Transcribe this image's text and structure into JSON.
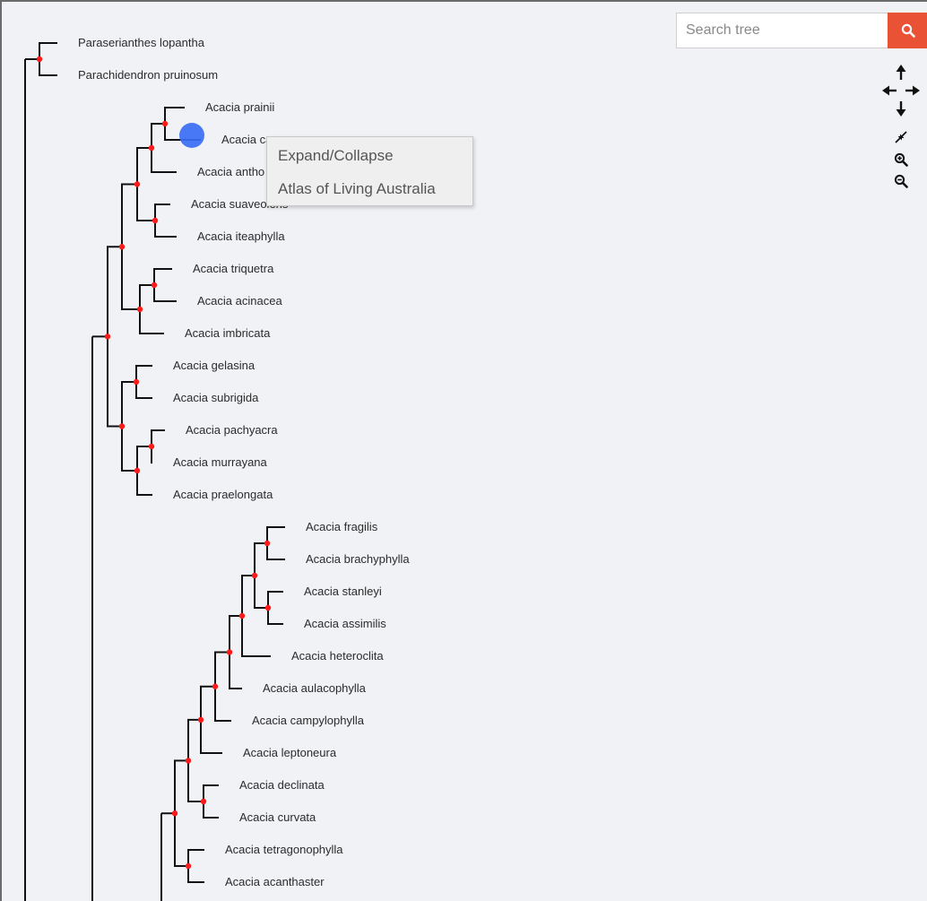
{
  "search": {
    "placeholder": "Search tree"
  },
  "context_menu": {
    "items": [
      "Expand/Collapse",
      "Atlas of Living Australia"
    ]
  },
  "controls": [
    "pan-icon",
    "reset-zoom-icon",
    "zoom-in-icon",
    "zoom-out-icon"
  ],
  "colors": {
    "node": "#ff1a1a",
    "branch": "#111111",
    "search_button": "#ea5235",
    "background": "#f0f2f6",
    "cursor": "#3b6ef5"
  },
  "tree": {
    "leaves": [
      "Paraserianthes lopantha",
      "Parachidendron pruinosum",
      "Acacia prainii",
      "Acacia can",
      "Acacia antho",
      "Acacia suaveolens",
      "Acacia iteaphylla",
      "Acacia triquetra",
      "Acacia acinacea",
      "Acacia imbricata",
      "Acacia gelasina",
      "Acacia subrigida",
      "Acacia pachyacra",
      "Acacia murrayana",
      "Acacia praelongata",
      "Acacia fragilis",
      "Acacia brachyphylla",
      "Acacia stanleyi",
      "Acacia assimilis",
      "Acacia heteroclita",
      "Acacia aulacophylla",
      "Acacia campylophylla",
      "Acacia leptoneura",
      "Acacia declinata",
      "Acacia curvata",
      "Acacia tetragonophylla",
      "Acacia acanthaster"
    ]
  }
}
